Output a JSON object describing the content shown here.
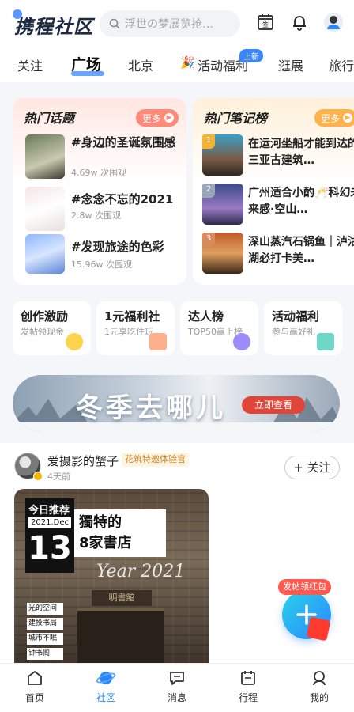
{
  "header": {
    "brand": "携程社区",
    "search_placeholder": "浮世の梦展览抢…",
    "calendar_label": "签"
  },
  "tabs": [
    {
      "label": "关注"
    },
    {
      "label": "广场"
    },
    {
      "label": "北京"
    },
    {
      "label": "活动福利",
      "badge": "上新"
    },
    {
      "label": "逛展"
    },
    {
      "label": "旅行"
    }
  ],
  "hot_topics": {
    "title": "热门话题",
    "more": "更多",
    "items": [
      {
        "title": "#身边的圣诞氛围感",
        "views": "4.69w 次围观"
      },
      {
        "title": "#念念不忘的2021",
        "views": "2.8w 次围观"
      },
      {
        "title": "#发现旅途的色彩",
        "views": "15.96w 次围观"
      }
    ]
  },
  "hot_notes": {
    "title": "热门笔记榜",
    "more": "更多",
    "items": [
      {
        "rank": "1",
        "title": "在运河坐船才能到达的三亚古建筑…"
      },
      {
        "rank": "2",
        "title": "广州适合小酌🥂科幻未来感·空山…"
      },
      {
        "rank": "3",
        "title": "深山蒸汽石锅鱼｜泸沽湖必打卡美…"
      }
    ]
  },
  "quick_entries": [
    {
      "title": "创作激励",
      "subtitle": "发帖领现金"
    },
    {
      "title": "1元福利社",
      "subtitle": "1元享吃住玩"
    },
    {
      "title": "达人榜",
      "subtitle": "TOP50赢上榜"
    },
    {
      "title": "活动福利",
      "subtitle": "参与赢好礼"
    }
  ],
  "banner": {
    "title": "冬季去哪儿",
    "button": "立即查看"
  },
  "post": {
    "author": "爱摄影的蟹子",
    "author_tag": "花筑特邀体验官",
    "time": "4天前",
    "follow": "+ 关注",
    "image": {
      "rec_label": "今日推荐",
      "date": "2021.Dec",
      "day": "13",
      "title_line1": "獨特的",
      "title_line2": "8家書店",
      "year": "Year 2021",
      "side_tags": [
        "光的空间",
        "建投书局",
        "城市不眠",
        "钟书阁"
      ],
      "signboard": "明書館"
    }
  },
  "fab": {
    "tag": "发帖领红包"
  },
  "bottom_nav": [
    {
      "label": "首页"
    },
    {
      "label": "社区"
    },
    {
      "label": "消息"
    },
    {
      "label": "行程"
    },
    {
      "label": "我的"
    }
  ],
  "colors": {
    "accent": "#2a86ff",
    "topics_more": "#ff8a7a",
    "notes_more": "#ffb24c",
    "banner_button": "#e0453a"
  }
}
